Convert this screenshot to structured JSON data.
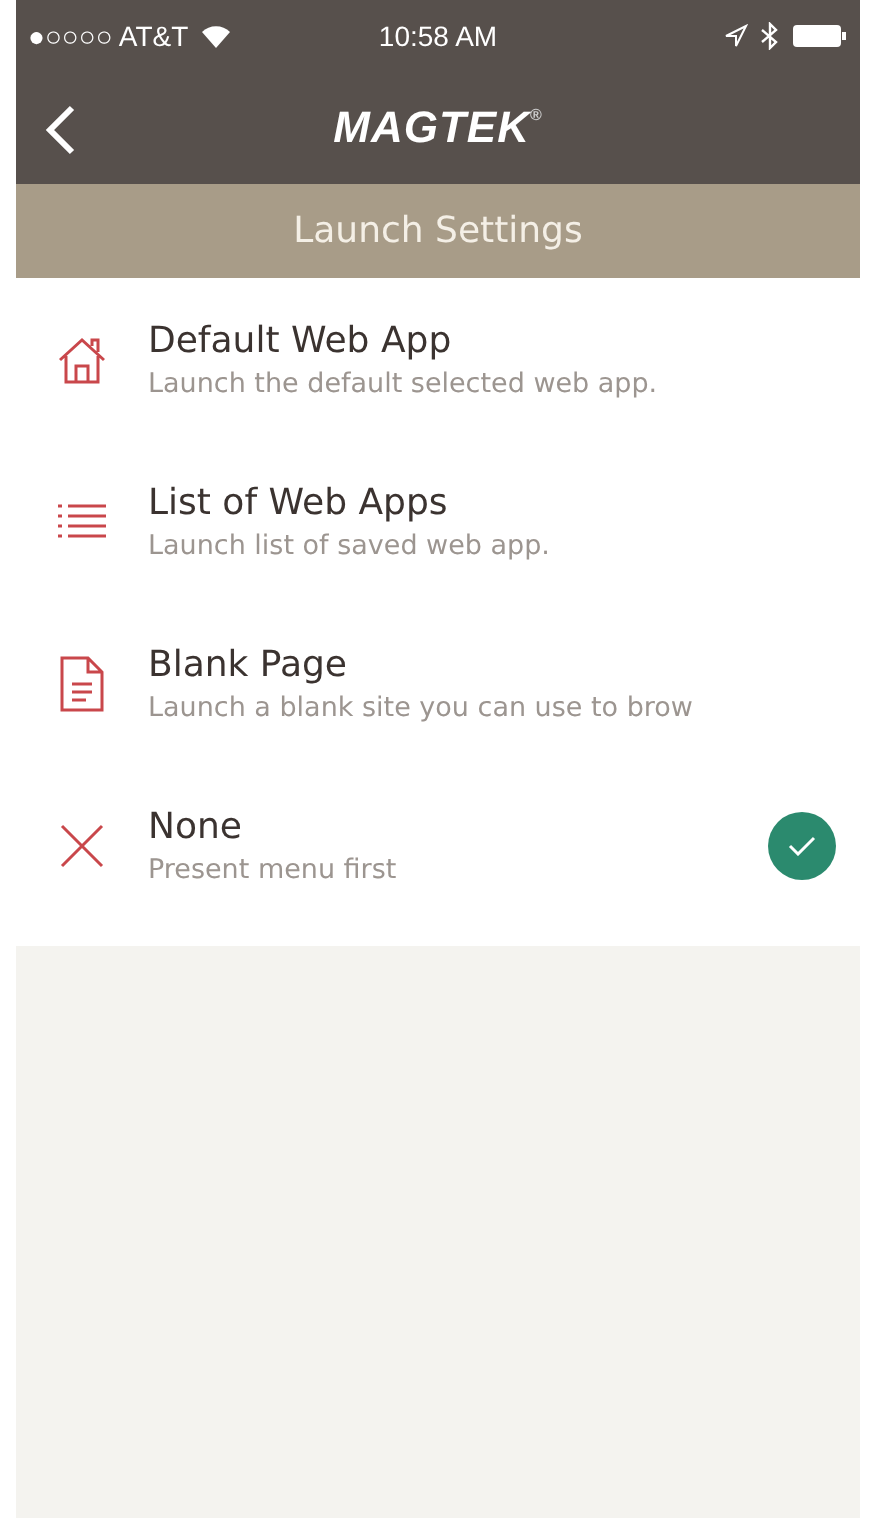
{
  "status_bar": {
    "carrier": "●○○○○ AT&T",
    "time": "10:58 AM"
  },
  "nav": {
    "logo": "MAGTEK",
    "logo_mark": "®"
  },
  "header": {
    "title": "Launch Settings"
  },
  "options": [
    {
      "kind": "home",
      "title": "Default Web App",
      "subtitle": "Launch the default selected web app.",
      "selected": false
    },
    {
      "kind": "list",
      "title": "List of Web Apps",
      "subtitle": "Launch list of saved web app.",
      "selected": false
    },
    {
      "kind": "page",
      "title": "Blank Page",
      "subtitle": "Launch a blank site you can use to brow",
      "selected": false
    },
    {
      "kind": "none",
      "title": "None",
      "subtitle": "Present menu first",
      "selected": true
    }
  ]
}
